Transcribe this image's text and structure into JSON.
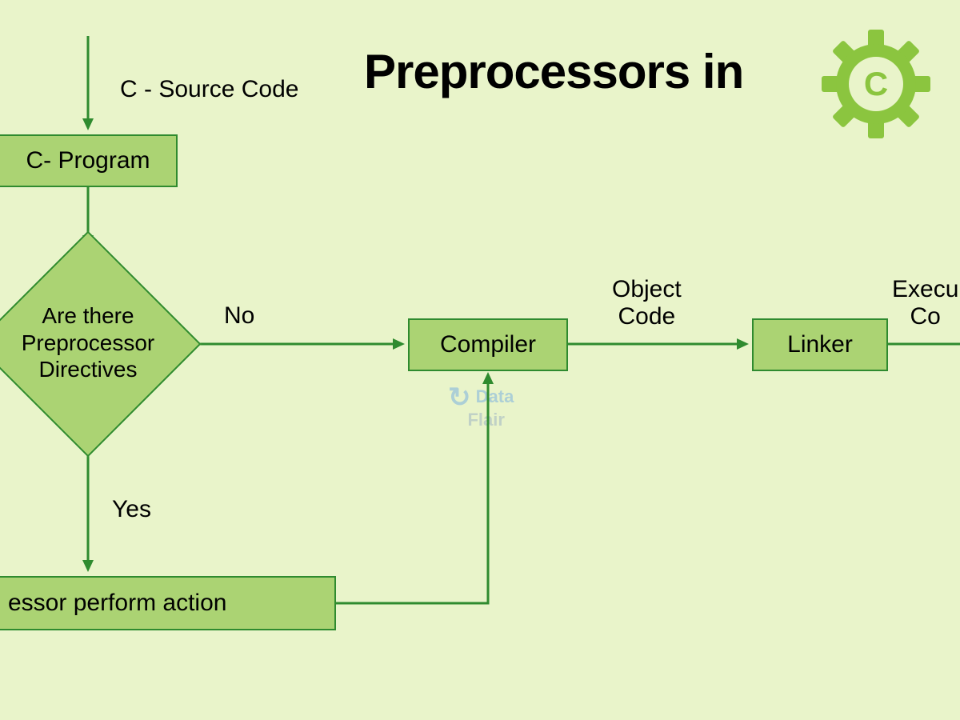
{
  "title": "Preprocessors in",
  "logo": {
    "letter": "C"
  },
  "labels": {
    "sourceCode": "C - Source Code",
    "no": "No",
    "yes": "Yes",
    "objectCode": "Object\nCode",
    "execCode": "Execu\nCo"
  },
  "nodes": {
    "cProgram": "C- Program",
    "decision": "Are there\nPreprocessor\nDirectives",
    "preprocessorAction": "essor perform action",
    "compiler": "Compiler",
    "linker": "Linker"
  },
  "watermark": {
    "line1": "Data",
    "line2": "Flair"
  },
  "colors": {
    "bg": "#e9f4ca",
    "nodeFill": "#abd373",
    "border": "#2f8b2f",
    "gear": "#8bc53f"
  }
}
